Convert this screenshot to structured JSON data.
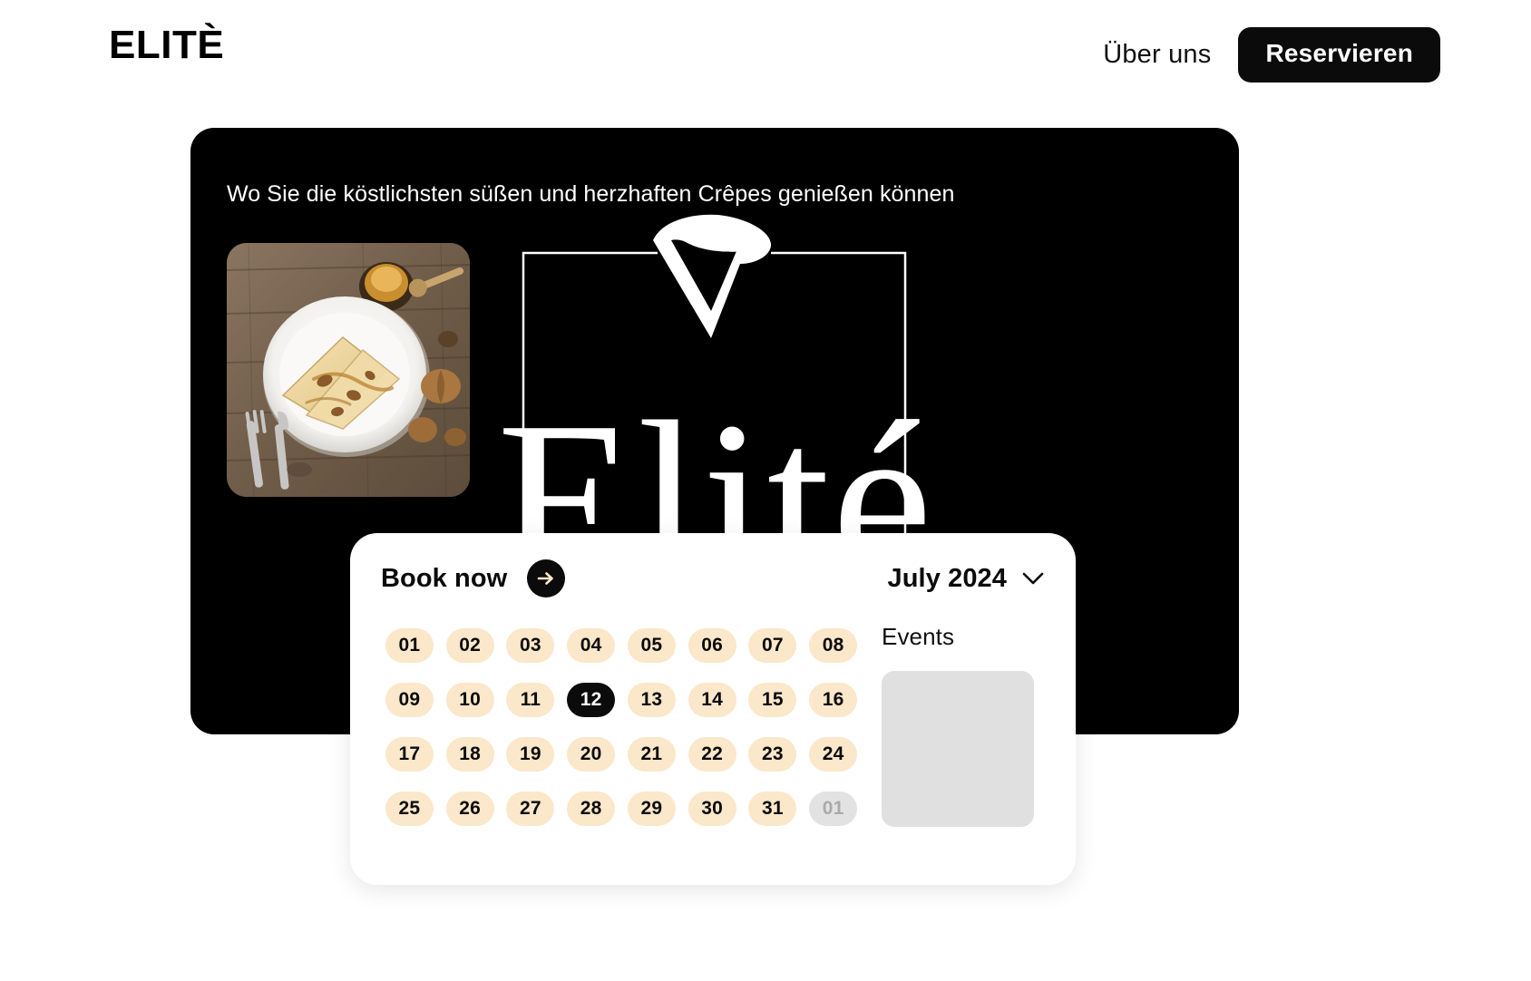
{
  "header": {
    "logo": "ELITÈ",
    "nav_link": "Über uns",
    "reserve_button": "Reservieren"
  },
  "hero": {
    "tagline": "Wo Sie die köstlichsten süßen und herzhaften Crêpes genießen können",
    "wordmark": "Elité",
    "thumbnail_alt": "crepes-on-plate-photo",
    "logo_icon": "crepe-cone-icon",
    "background_color": "#000000"
  },
  "booking": {
    "title": "Book now",
    "arrow_icon": "arrow-right-icon",
    "month": "July 2024",
    "chevron_icon": "chevron-down-icon",
    "events_label": "Events",
    "selected_day": "12",
    "days": [
      {
        "label": "01",
        "state": "normal"
      },
      {
        "label": "02",
        "state": "normal"
      },
      {
        "label": "03",
        "state": "normal"
      },
      {
        "label": "04",
        "state": "normal"
      },
      {
        "label": "05",
        "state": "normal"
      },
      {
        "label": "06",
        "state": "normal"
      },
      {
        "label": "07",
        "state": "normal"
      },
      {
        "label": "08",
        "state": "normal"
      },
      {
        "label": "09",
        "state": "normal"
      },
      {
        "label": "10",
        "state": "normal"
      },
      {
        "label": "11",
        "state": "normal"
      },
      {
        "label": "12",
        "state": "selected"
      },
      {
        "label": "13",
        "state": "normal"
      },
      {
        "label": "14",
        "state": "normal"
      },
      {
        "label": "15",
        "state": "normal"
      },
      {
        "label": "16",
        "state": "normal"
      },
      {
        "label": "17",
        "state": "normal"
      },
      {
        "label": "18",
        "state": "normal"
      },
      {
        "label": "19",
        "state": "normal"
      },
      {
        "label": "20",
        "state": "normal"
      },
      {
        "label": "21",
        "state": "normal"
      },
      {
        "label": "22",
        "state": "normal"
      },
      {
        "label": "23",
        "state": "normal"
      },
      {
        "label": "24",
        "state": "normal"
      },
      {
        "label": "25",
        "state": "normal"
      },
      {
        "label": "26",
        "state": "normal"
      },
      {
        "label": "27",
        "state": "normal"
      },
      {
        "label": "28",
        "state": "normal"
      },
      {
        "label": "29",
        "state": "normal"
      },
      {
        "label": "30",
        "state": "normal"
      },
      {
        "label": "31",
        "state": "normal"
      },
      {
        "label": "01",
        "state": "muted"
      }
    ]
  },
  "colors": {
    "page_background": "#FFFFFF",
    "hero_background": "#000000",
    "accent_cream": "#FBE7C9",
    "selected_black": "#0B0B0B",
    "muted_gray": "#E2E2E2",
    "events_panel_gray": "#E0E0E0"
  }
}
